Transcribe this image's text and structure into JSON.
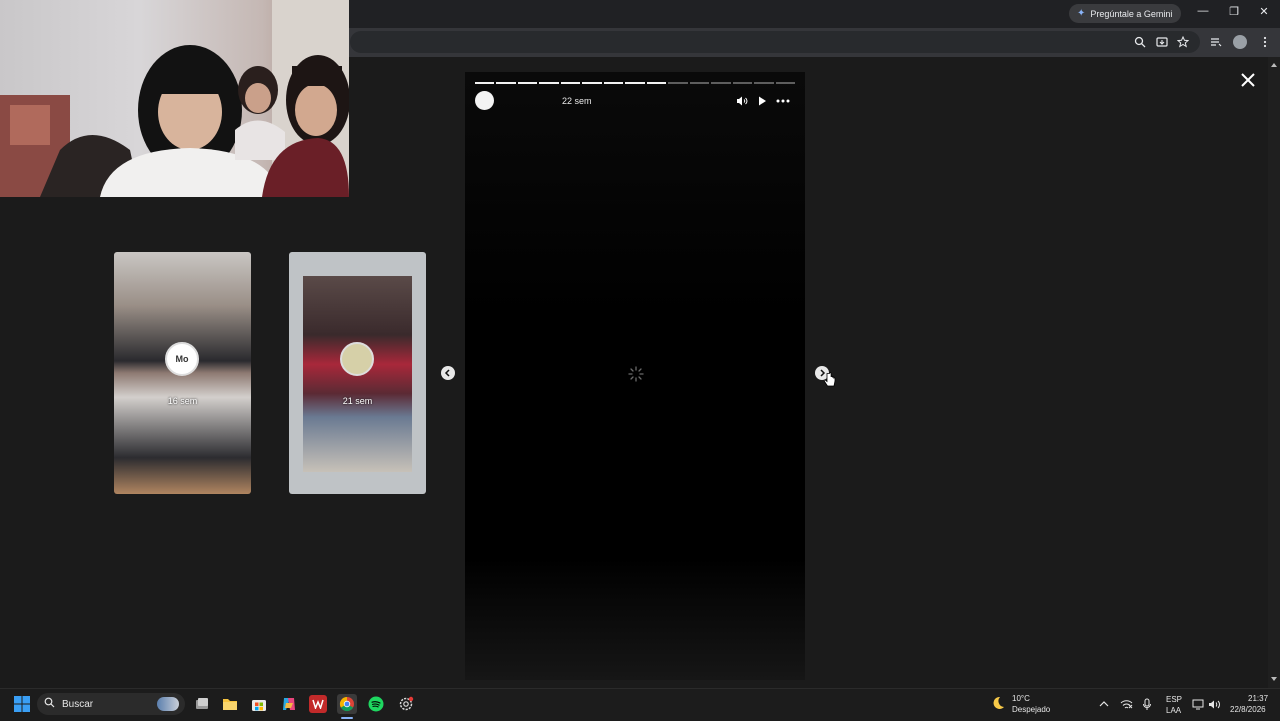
{
  "browser": {
    "gemini_button": "Pregúntale a Gemini",
    "toolbar_icons": [
      "zoom-icon",
      "install-app-icon",
      "bookmark-star-icon",
      "reading-list-icon",
      "profile-icon",
      "menu-icon"
    ],
    "window_controls": [
      "minimize",
      "restore",
      "close"
    ]
  },
  "story_viewer": {
    "progress": {
      "total_segments": 15,
      "completed_segments": 9
    },
    "current_story": {
      "time_ago": "22 sem",
      "status": "loading"
    },
    "controls": [
      "mute-icon",
      "play-icon",
      "more-options-icon"
    ],
    "previous_stories": [
      {
        "time_ago": "16 sem",
        "avatar_text": "Mo"
      },
      {
        "time_ago": "21 sem",
        "avatar_text": ""
      }
    ]
  },
  "taskbar": {
    "search_placeholder": "Buscar",
    "apps": [
      "windows-start-icon",
      "task-view-icon",
      "file-explorer-icon",
      "microsoft-store-icon",
      "copilot-icon",
      "wps-office-icon",
      "chrome-icon",
      "spotify-icon",
      "settings-app-icon"
    ],
    "weather": {
      "temperature": "10°C",
      "condition": "Despejado"
    },
    "language": {
      "line1": "ESP",
      "line2": "LAA"
    },
    "clock": {
      "time": "21:37",
      "date": "22/8/2026"
    }
  }
}
